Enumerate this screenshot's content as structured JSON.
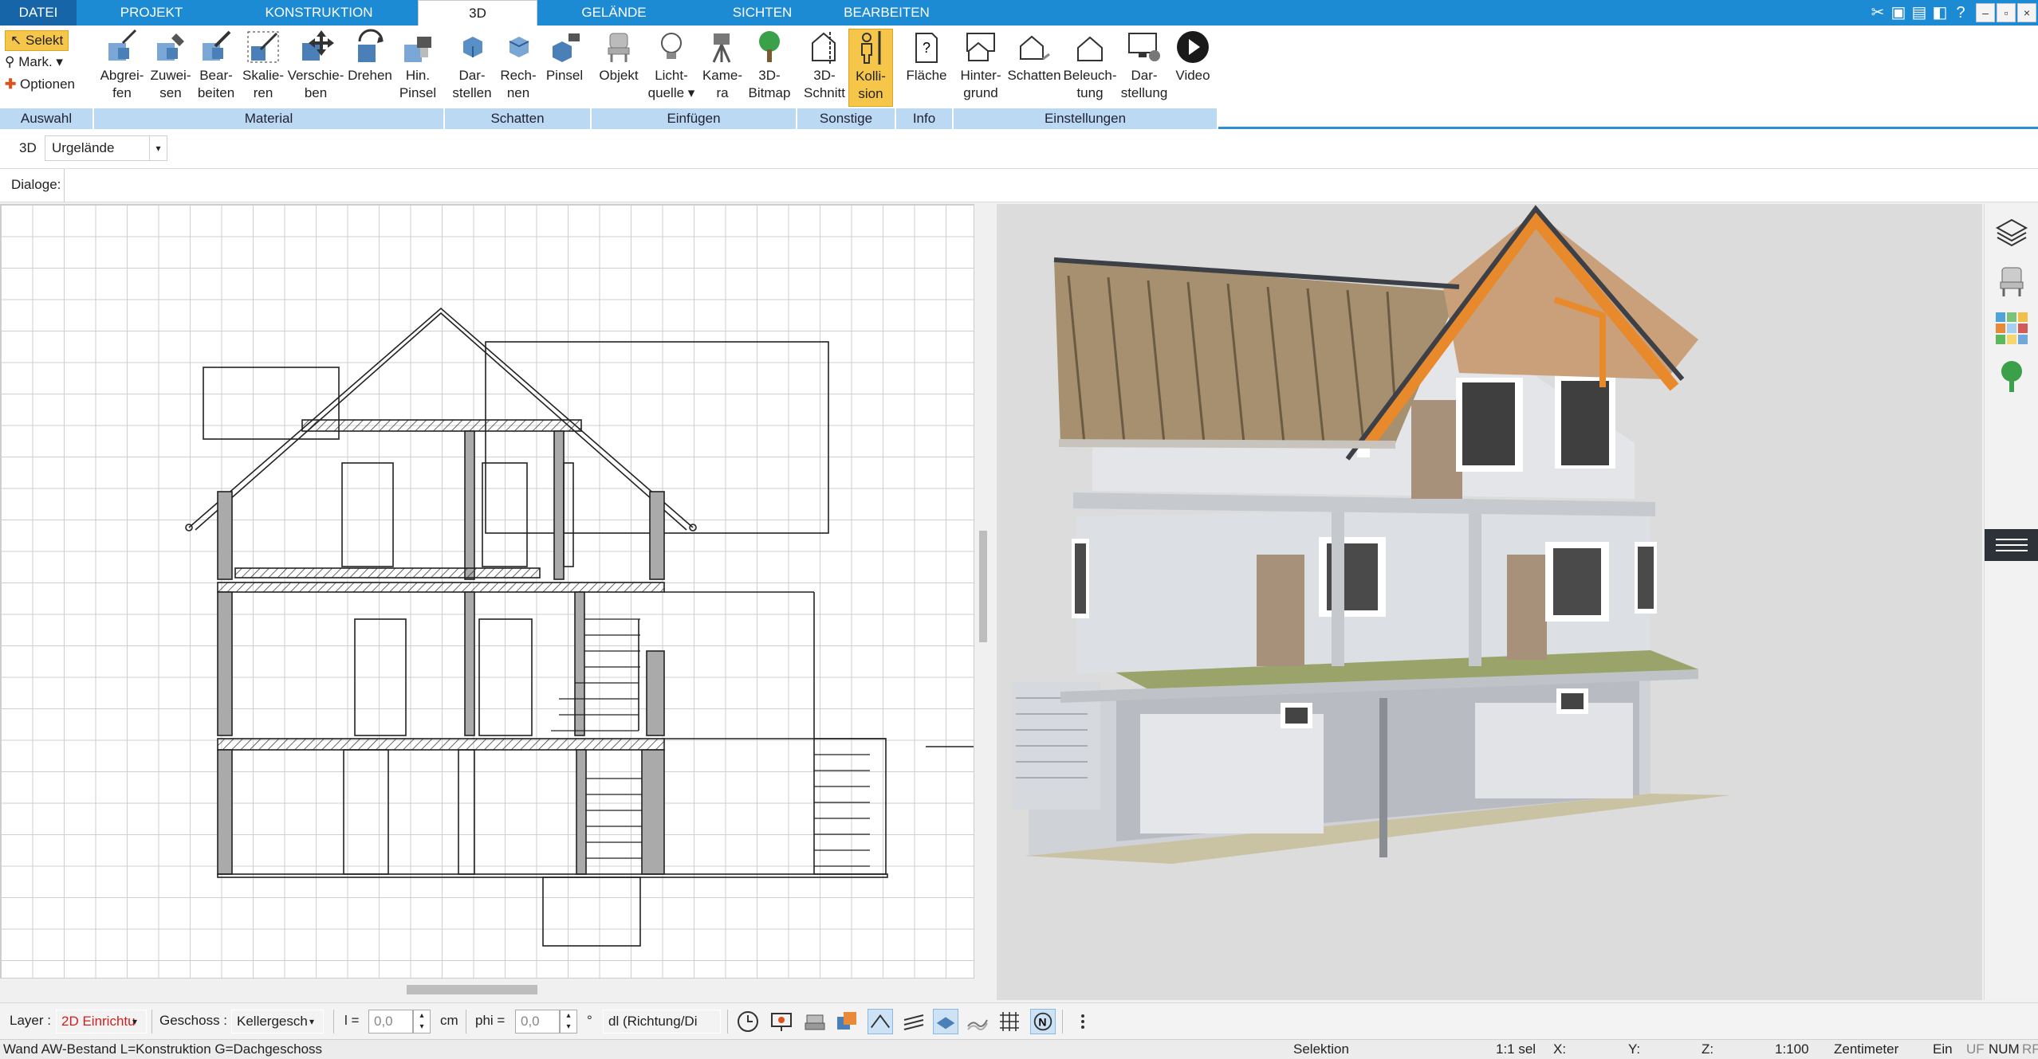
{
  "tabs": {
    "datei": "DATEI",
    "projekt": "PROJEKT",
    "konstruktion": "KONSTRUKTION",
    "d3": "3D",
    "gelaende": "GELÄNDE",
    "sichten": "SICHTEN",
    "bearbeiten": "BEARBEITEN"
  },
  "ribbon": {
    "auswahl": {
      "selekt": "Selekt",
      "mark": "Mark.",
      "optionen": "Optionen",
      "group": "Auswahl"
    },
    "material": {
      "group": "Material",
      "abgreifen": [
        "Abgrei-",
        "fen"
      ],
      "zuweisen": [
        "Zuwei-",
        "sen"
      ],
      "bearbeiten": [
        "Bear-",
        "beiten"
      ],
      "skalieren": [
        "Skalie-",
        "ren"
      ],
      "verschieben": [
        "Verschie-",
        "ben"
      ],
      "drehen": [
        "Drehen",
        ""
      ],
      "hinpinsel": [
        "Hin.",
        "Pinsel"
      ]
    },
    "schatten": {
      "group": "Schatten",
      "darstellen": [
        "Dar-",
        "stellen"
      ],
      "rechnen": [
        "Rech-",
        "nen"
      ],
      "pinsel": [
        "Pinsel",
        ""
      ]
    },
    "einfuegen": {
      "group": "Einfügen",
      "objekt": [
        "Objekt",
        ""
      ],
      "lichtquelle": [
        "Licht-",
        "quelle"
      ],
      "kamera": [
        "Kame-",
        "ra"
      ],
      "bitmap": [
        "3D-",
        "Bitmap"
      ]
    },
    "sonstige": {
      "group": "Sonstige",
      "schnitt": [
        "3D-",
        "Schnitt"
      ],
      "kollision": [
        "Kolli-",
        "sion"
      ]
    },
    "info": {
      "group": "Info",
      "flaeche": [
        "Fläche",
        ""
      ]
    },
    "einstellungen": {
      "group": "Einstellungen",
      "hintergrund": [
        "Hinter-",
        "grund"
      ],
      "schatten": [
        "Schatten",
        ""
      ],
      "beleuchtung": [
        "Beleuch-",
        "tung"
      ],
      "darstellung": [
        "Dar-",
        "stellung"
      ],
      "video": [
        "Video",
        ""
      ]
    }
  },
  "row3d": {
    "label": "3D",
    "dropdown": "Urgelände"
  },
  "dialoge": {
    "label": "Dialoge:"
  },
  "bottom": {
    "layer_label": "Layer :",
    "layer_value": "2D Einrichtu",
    "geschoss_label": "Geschoss :",
    "geschoss_value": "Kellergesch",
    "l_label": "l =",
    "l_value": "0,0",
    "cm": "cm",
    "phi_label": "phi =",
    "phi_value": "0,0",
    "deg": "°",
    "dl_value": "dl (Richtung/Di"
  },
  "status": {
    "left": "Wand AW-Bestand L=Konstruktion G=Dachgeschoss",
    "selektion": "Selektion",
    "scale_sel": "1:1 sel",
    "x": "X:",
    "y": "Y:",
    "z": "Z:",
    "scale": "1:100",
    "unit": "Zentimeter",
    "ein": "Ein",
    "uf": "UF",
    "num": "NUM",
    "rf": "RF"
  },
  "colors": {
    "accent": "#1d8ad4",
    "ribbon_group": "#bcd9f4",
    "active": "#f6c64a",
    "layer_value": "#d11f1f"
  },
  "icons": [
    "search-icon",
    "layers-icon",
    "chair-icon",
    "palette-icon",
    "tree-icon",
    "menu-icon"
  ]
}
